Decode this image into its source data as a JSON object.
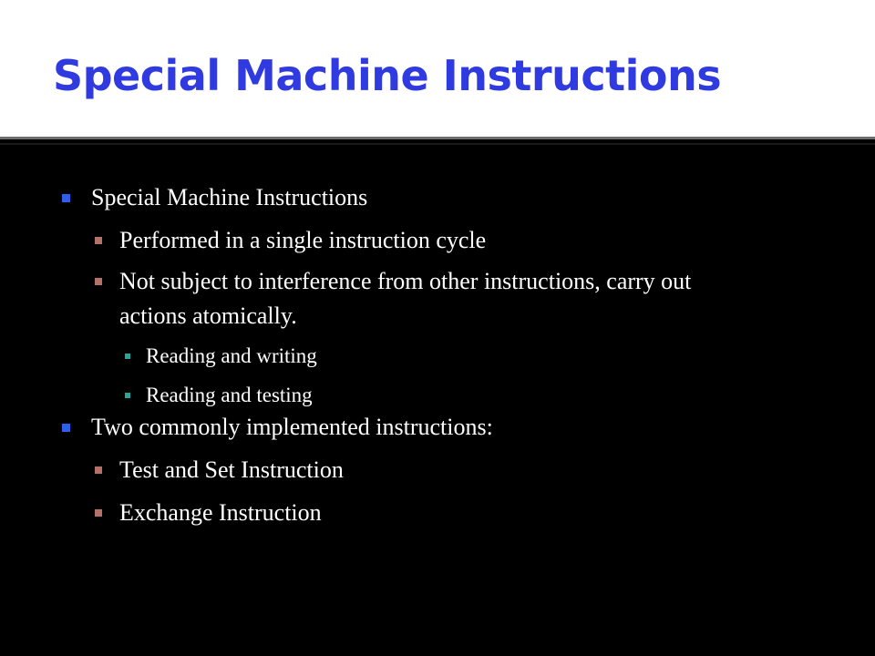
{
  "slide": {
    "title": "Special Machine Instructions"
  },
  "bullets": {
    "b1": "Special Machine Instructions",
    "b1_1": "Performed in a single instruction cycle",
    "b1_2_line1": "Not subject to interference from other instructions, carry out",
    "b1_2_line2": "actions atomically.",
    "b1_2_1": "Reading and writing",
    "b1_2_2": "Reading and testing",
    "b2": "Two commonly implemented instructions:",
    "b2_1": "Test and Set Instruction",
    "b2_2": "Exchange Instruction"
  },
  "colors": {
    "title": "#2f3ae0",
    "level1_bullet": "#2f5fe8",
    "level2_bullet": "#b3716a",
    "level3_bullet": "#2aa39a",
    "text": "#ffffff",
    "background": "#000000"
  }
}
